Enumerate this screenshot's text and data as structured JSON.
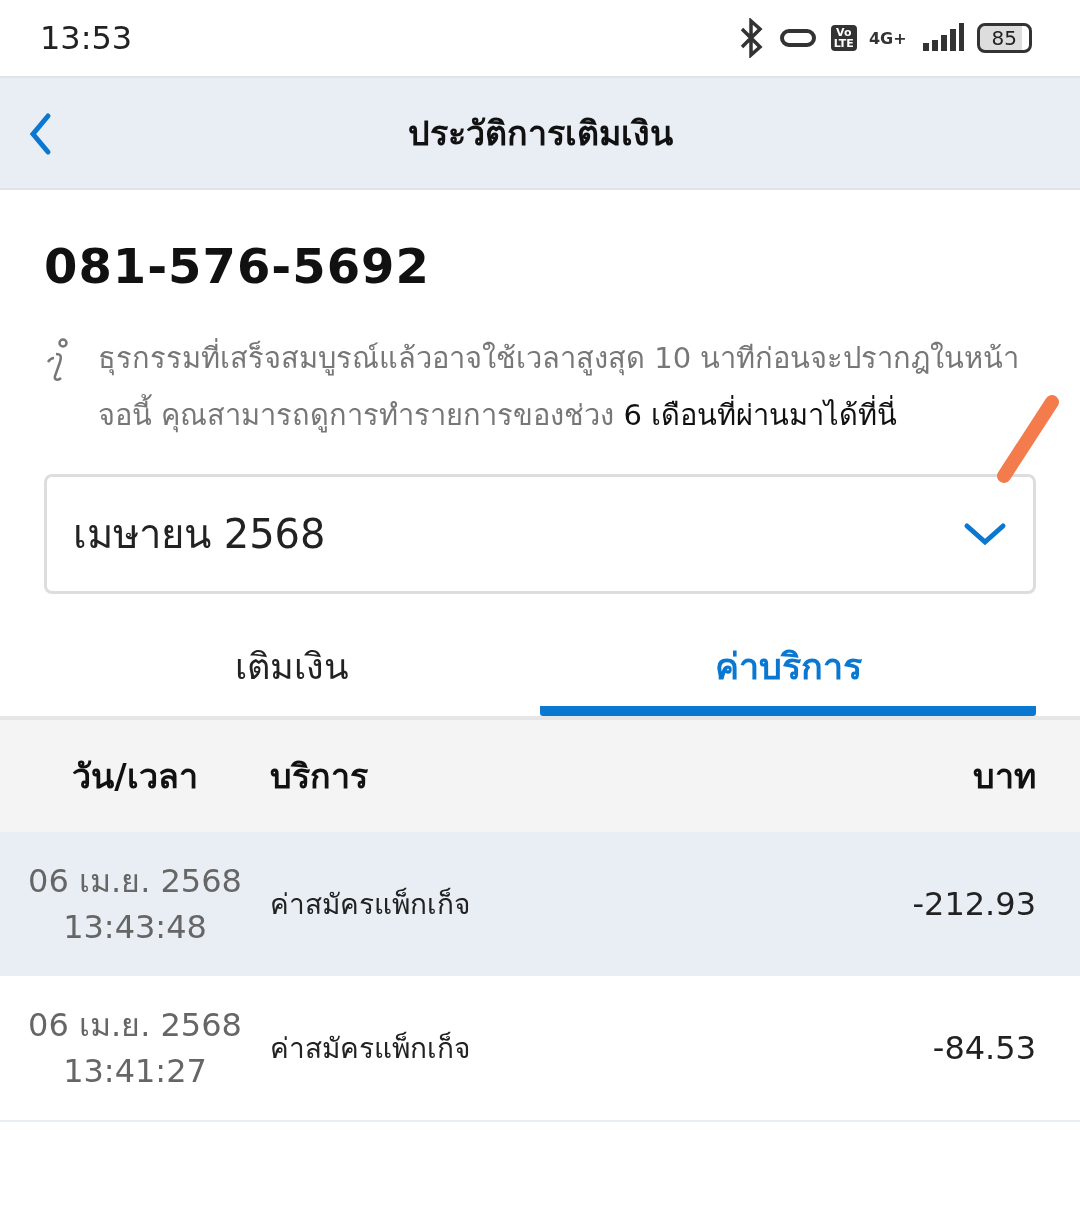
{
  "status_bar": {
    "time": "13:53",
    "network": "4G+",
    "volte": [
      "Vo",
      "LTE"
    ],
    "battery": "85"
  },
  "header": {
    "title": "ประวัติการเติมเงิน"
  },
  "phone_number": "081-576-5692",
  "notice": {
    "text": "ธุรกรรมที่เสร็จสมบูรณ์แล้วอาจใช้เวลาสูงสุด 10 นาทีก่อนจะปรากฎในหน้าจอนี้ คุณสามารถดูการทำรายการของช่วง",
    "link": "6 เดือนที่ผ่านมาได้ที่นี่"
  },
  "month_select": {
    "value": "เมษายน 2568"
  },
  "tabs": [
    {
      "label": "เติมเงิน",
      "selected": false
    },
    {
      "label": "ค่าบริการ",
      "selected": true
    }
  ],
  "table": {
    "columns": [
      "วัน/เวลา",
      "บริการ",
      "บาท"
    ],
    "rows": [
      {
        "date": "06 เม.ย. 2568",
        "time": "13:43:48",
        "service": "ค่าสมัครแพ็กเก็จ",
        "amount": "-212.93"
      },
      {
        "date": "06 เม.ย. 2568",
        "time": "13:41:27",
        "service": "ค่าสมัครแพ็กเก็จ",
        "amount": "-84.53"
      }
    ]
  }
}
